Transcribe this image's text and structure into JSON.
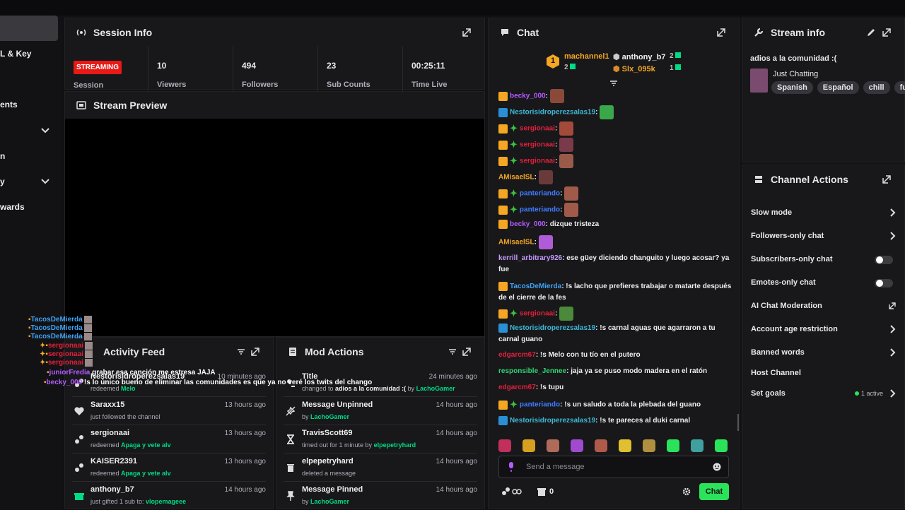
{
  "sidebar": {
    "items": [
      {
        "label": "L & Key"
      },
      {
        "label": "ents"
      },
      {
        "label": "n"
      },
      {
        "label": "y"
      },
      {
        "label": "wards"
      }
    ]
  },
  "session": {
    "title": "Session Info",
    "status_badge": "STREAMING",
    "status_label": "Session",
    "stats": [
      {
        "value": "10",
        "label": "Viewers"
      },
      {
        "value": "494",
        "label": "Followers"
      },
      {
        "value": "23",
        "label": "Sub Counts"
      },
      {
        "value": "00:25:11",
        "label": "Time Live"
      }
    ]
  },
  "preview": {
    "title": "Stream Preview"
  },
  "activity": {
    "title": "Activity Feed",
    "items": [
      {
        "name": "Nestorisidroperezsalas19",
        "desc": "redeemed ",
        "highlight": "Melo",
        "time": "10 minutes ago"
      },
      {
        "name": "Saraxx15",
        "desc": "just followed the channel",
        "highlight": "",
        "time": "13 hours ago"
      },
      {
        "name": "sergionaai",
        "desc": "redeemed ",
        "highlight": "Apaga y vete alv",
        "time": "13 hours ago"
      },
      {
        "name": "KAISER2391",
        "desc": "redeemed ",
        "highlight": "Apaga y vete alv",
        "time": "13 hours ago"
      },
      {
        "name": "anthony_b7",
        "desc": "just gifted 1 sub to: ",
        "highlight": "vlopemageee",
        "time": "14 hours ago"
      }
    ]
  },
  "mod": {
    "title": "Mod Actions",
    "items": [
      {
        "name": "Title",
        "desc": "changed to ",
        "highlight": "adios a la comunidad :(",
        "desc2": " by ",
        "by": "LachoGamer",
        "time": "24 minutes ago"
      },
      {
        "name": "Message Unpinned",
        "desc": "by ",
        "highlight": "",
        "desc2": "",
        "by": "LachoGamer",
        "time": "14 hours ago"
      },
      {
        "name": "TravisScott69",
        "desc": "timed out for 1 minute by ",
        "highlight": "",
        "desc2": "",
        "by": "elpepetryhard",
        "time": "14 hours ago"
      },
      {
        "name": "elpepetryhard",
        "desc": "deleted a message",
        "highlight": "",
        "desc2": "",
        "by": "",
        "time": "14 hours ago"
      },
      {
        "name": "Message Pinned",
        "desc": "by ",
        "highlight": "",
        "desc2": "",
        "by": "LachoGamer",
        "time": "14 hours ago"
      }
    ]
  },
  "chat": {
    "title": "Chat",
    "leaders": [
      {
        "name": "machannel1",
        "count": "2"
      },
      {
        "name": "anthony_b7",
        "count": "2"
      },
      {
        "name": "Slx_095k",
        "count": "1"
      }
    ],
    "rank": "1",
    "messages": [
      {
        "name": "becky_000",
        "color": "#b45cff",
        "text": "",
        "badges": [
          "crown"
        ],
        "emote": true
      },
      {
        "name": "Nestorisidroperezsalas19",
        "color": "#3fb8d6",
        "text": "",
        "badges": [
          "vip"
        ],
        "emote": true
      },
      {
        "name": "sergionaai",
        "color": "#e0203a",
        "text": "",
        "badges": [
          "crown",
          "spark"
        ],
        "emote": true
      },
      {
        "name": "sergionaai",
        "color": "#e0203a",
        "text": "",
        "badges": [
          "crown",
          "spark"
        ],
        "emote": true
      },
      {
        "name": "sergionaai",
        "color": "#e0203a",
        "text": "",
        "badges": [
          "crown",
          "spark"
        ],
        "emote": true
      },
      {
        "name": "AMisaelSL",
        "color": "#f5a623",
        "text": "",
        "badges": [],
        "emote": true
      },
      {
        "name": "panteriando",
        "color": "#3f7bff",
        "text": "",
        "badges": [
          "crown",
          "spark"
        ],
        "emote": true
      },
      {
        "name": "panteriando",
        "color": "#3f7bff",
        "text": "",
        "badges": [
          "crown",
          "spark"
        ],
        "emote": true
      },
      {
        "name": "becky_000",
        "color": "#b45cff",
        "text": "dizque tristeza",
        "badges": [
          "crown"
        ],
        "emote": false
      },
      {
        "name": "AMisaelSL",
        "color": "#f5a623",
        "text": "",
        "badges": [],
        "emote": true
      },
      {
        "name": "kerrill_arbitrary926",
        "color": "#c59bff",
        "text": "ese güey diciendo changuito y luego acosar? ya fue",
        "badges": [],
        "emote": false
      },
      {
        "name": "TacosDeMierda",
        "color": "#3fa2f5",
        "text": "!s lacho que prefieres trabajar o matarte después de el cierre de la fes",
        "badges": [
          "crown"
        ],
        "emote": false
      },
      {
        "name": "sergionaai",
        "color": "#e0203a",
        "text": "",
        "badges": [
          "crown",
          "spark"
        ],
        "emote": true
      },
      {
        "name": "Nestorisidroperezsalas19",
        "color": "#3fb8d6",
        "text": "!s carnal aguas que agarraron a tu carnal guano",
        "badges": [
          "vip"
        ],
        "emote": false
      },
      {
        "name": "edgarcm67",
        "color": "#e0203a",
        "text": "!s Melo con tu tío en el putero",
        "badges": [],
        "emote": false
      },
      {
        "name": "responsible_Jennee",
        "color": "#2fd46f",
        "text": "jaja ya se puso modo madera en el ratón",
        "badges": [],
        "emote": false
      },
      {
        "name": "edgarcm67",
        "color": "#e0203a",
        "text": "!s tupu",
        "badges": [],
        "emote": false
      },
      {
        "name": "panteriando",
        "color": "#3f7bff",
        "text": "!s un saludo a toda la plebada del guano",
        "badges": [
          "crown",
          "spark"
        ],
        "emote": false
      },
      {
        "name": "Nestorisidroperezsalas19",
        "color": "#3fb8d6",
        "text": "!s te pareces al duki carnal",
        "badges": [
          "vip"
        ],
        "emote": false
      }
    ],
    "input_placeholder": "Send a message",
    "points": "0",
    "send_label": "Chat"
  },
  "stream_info": {
    "title": "Stream info",
    "stream_title": "adios a la comunidad :(",
    "category": "Just Chatting",
    "tags": [
      "Spanish",
      "Español",
      "chill",
      "funn"
    ]
  },
  "channel_actions": {
    "title": "Channel Actions",
    "items": [
      {
        "label": "Slow mode",
        "control": "chevron"
      },
      {
        "label": "Followers-only chat",
        "control": "chevron"
      },
      {
        "label": "Subscribers-only chat",
        "control": "toggle"
      },
      {
        "label": "Emotes-only chat",
        "control": "toggle"
      },
      {
        "label": "AI Chat Moderation",
        "control": "popout"
      },
      {
        "label": "Account age restriction",
        "control": "chevron"
      },
      {
        "label": "Banned words",
        "control": "chevron"
      },
      {
        "label": "Host Channel",
        "control": "none"
      },
      {
        "label": "Set goals",
        "control": "chevron"
      }
    ],
    "goals_status": "1 active"
  },
  "overlay": {
    "lines": [
      {
        "name": "TacosDeMierda",
        "color": "#3fa2f5",
        "text": ""
      },
      {
        "name": "TacosDeMierda",
        "color": "#3fa2f5",
        "text": ""
      },
      {
        "name": "TacosDeMierda",
        "color": "#3fa2f5",
        "text": ""
      },
      {
        "name": "sergionaai",
        "color": "#e0203a",
        "text": ""
      },
      {
        "name": "sergionaai",
        "color": "#e0203a",
        "text": ""
      },
      {
        "name": "sergionaai",
        "color": "#e0203a",
        "text": ""
      },
      {
        "name": "juniorFredia",
        "color": "#b45cff",
        "text": "grabar esa canción me estresa JAJA"
      },
      {
        "name": "becky_000",
        "color": "#b45cff",
        "text": "!s lo único bueno de eliminar las comunidades es que ya no veré los twits del chango"
      }
    ]
  },
  "colors": {
    "accent": "#00db84",
    "live": "#e91916",
    "panel": "#18181b",
    "bg": "#111114"
  }
}
